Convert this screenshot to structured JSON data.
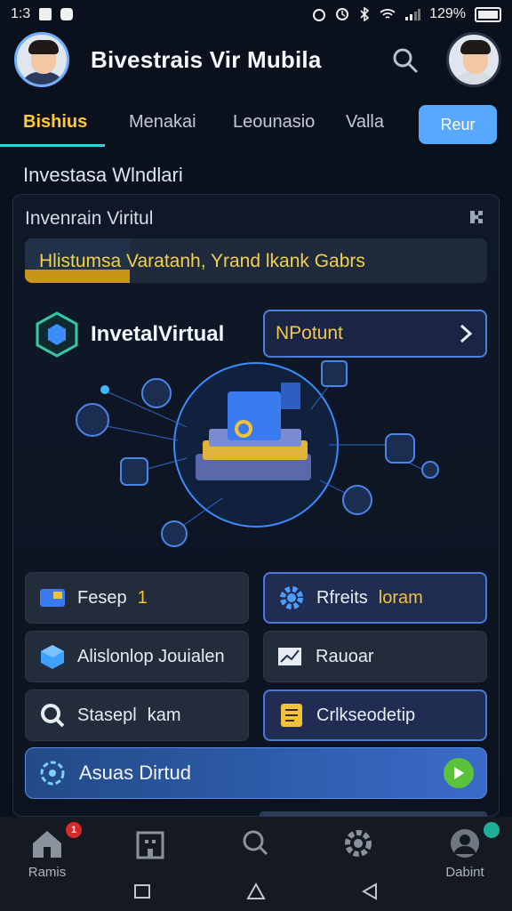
{
  "status_bar": {
    "time": "1:3",
    "battery": "129%"
  },
  "header": {
    "title": "Bivestrais Vir Mubila"
  },
  "tabs": [
    {
      "label": "Bishius",
      "active": true
    },
    {
      "label": "Menakai"
    },
    {
      "label": "Leounasio"
    },
    {
      "label": "Valla"
    }
  ],
  "tab_button": "Reur",
  "section_title": "Investasa Wlndlari",
  "panel": {
    "title": "Invenrain Viritul",
    "banner_text": "Hlistumsa Varatanh, Yrand lkank Gabrs",
    "brand": "InvetalVirtual",
    "np_button": "NPotunt"
  },
  "grid": [
    {
      "label": "Fesep",
      "suffix": "1",
      "style": "dark",
      "icon": "image-card-icon"
    },
    {
      "label": "Rfreits",
      "suffix": "loram",
      "style": "blue",
      "icon": "gear-icon"
    },
    {
      "label": "Alislonlop Jouialen",
      "style": "dark",
      "icon": "cube-icon"
    },
    {
      "label": "Rauoar",
      "style": "dark",
      "icon": "chart-icon"
    },
    {
      "label": "Stasepl",
      "suffix": "kam",
      "style": "dark",
      "icon": "search-icon"
    },
    {
      "label": "Crlkseodetip",
      "style": "blue",
      "icon": "document-icon"
    }
  ],
  "wide_button": "Asuas Dirtud",
  "bottom_nav": [
    {
      "label": "Ramis",
      "icon": "home-icon",
      "badge": "1"
    },
    {
      "label": "",
      "icon": "building-icon"
    },
    {
      "label": "",
      "icon": "search-icon"
    },
    {
      "label": "",
      "icon": "gear-icon"
    },
    {
      "label": "Dabint",
      "icon": "profile-icon",
      "badge": ""
    }
  ],
  "colors": {
    "accent_yellow": "#ffc93a",
    "accent_blue": "#59a8ff",
    "tab_underline": "#35d0e0",
    "play_green": "#5bc23c"
  }
}
